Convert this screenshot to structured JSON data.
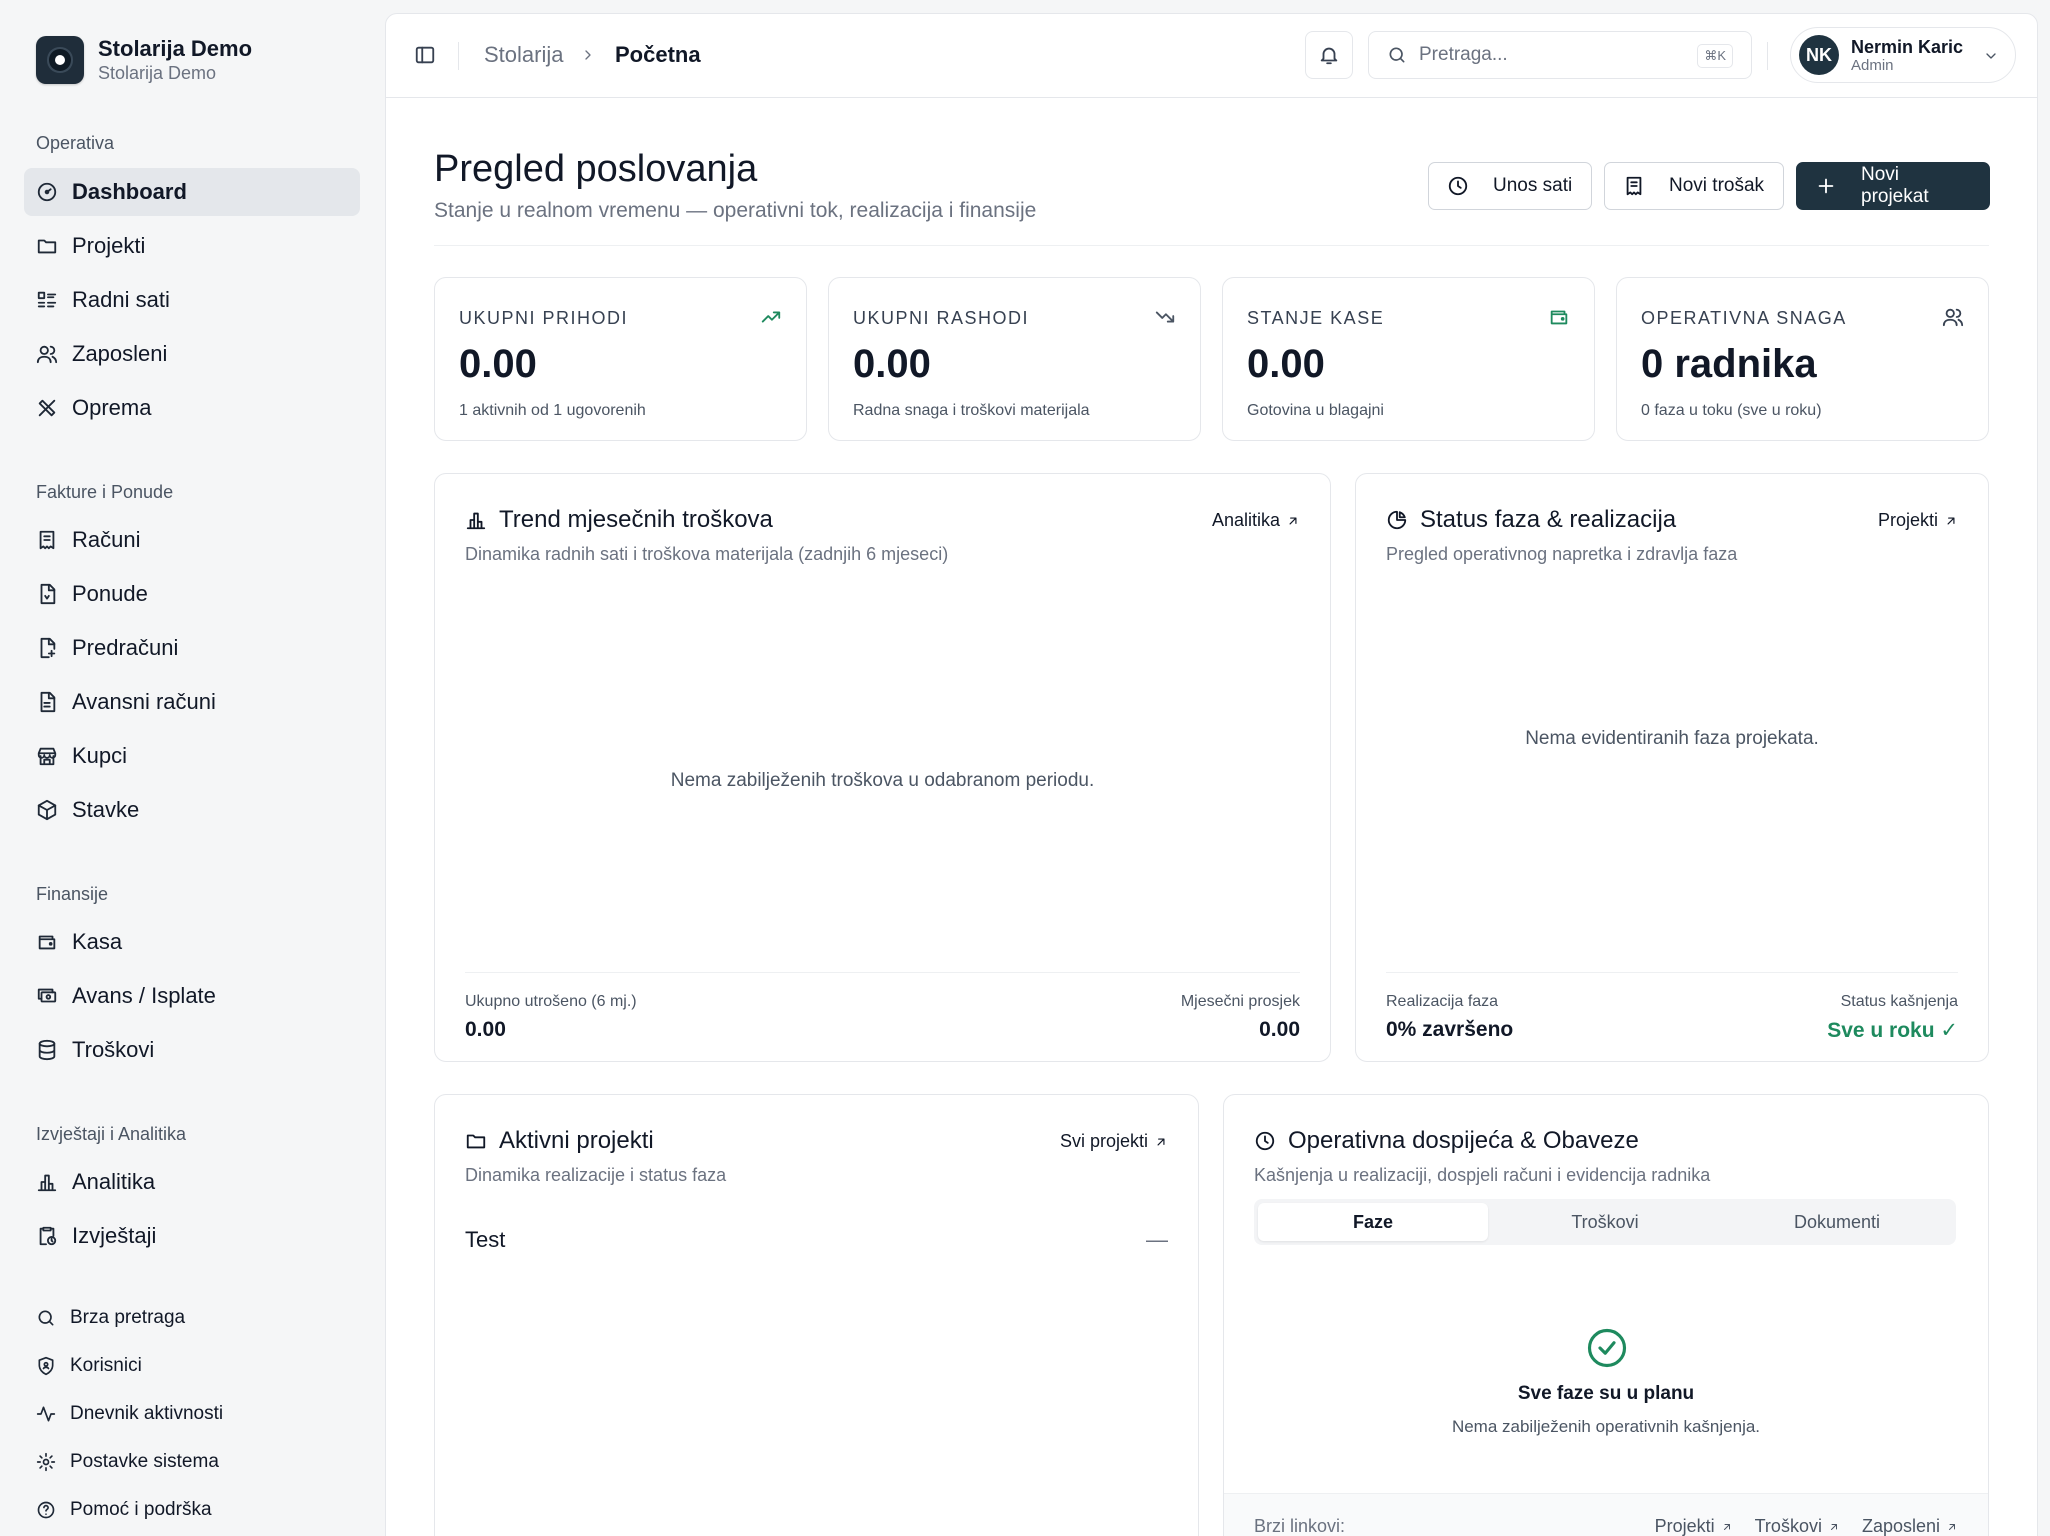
{
  "brand": {
    "name": "Stolarija Demo",
    "sub": "Stolarija Demo"
  },
  "sidebar": {
    "sections": [
      {
        "title": "Operativa"
      },
      {
        "title": "Fakture i Ponude"
      },
      {
        "title": "Finansije"
      },
      {
        "title": "Izvještaji i Analitika"
      }
    ],
    "items": [
      {
        "label": "Dashboard",
        "icon": "gauge-icon"
      },
      {
        "label": "Projekti",
        "icon": "folder-icon"
      },
      {
        "label": "Radni sati",
        "icon": "list-checks-icon"
      },
      {
        "label": "Zaposleni",
        "icon": "users-icon"
      },
      {
        "label": "Oprema",
        "icon": "tools-icon"
      },
      {
        "label": "Računi",
        "icon": "receipt-icon"
      },
      {
        "label": "Ponude",
        "icon": "file-quote-icon"
      },
      {
        "label": "Predračuni",
        "icon": "file-ai-icon"
      },
      {
        "label": "Avansni računi",
        "icon": "file-text-icon"
      },
      {
        "label": "Kupci",
        "icon": "store-icon"
      },
      {
        "label": "Stavke",
        "icon": "package-icon"
      },
      {
        "label": "Kasa",
        "icon": "wallet-icon"
      },
      {
        "label": "Avans / Isplate",
        "icon": "cash-icon"
      },
      {
        "label": "Troškovi",
        "icon": "database-icon"
      },
      {
        "label": "Analitika",
        "icon": "bar-chart-icon"
      },
      {
        "label": "Izvještaji",
        "icon": "report-icon"
      }
    ],
    "bottom": [
      {
        "label": "Brza pretraga",
        "icon": "search-icon"
      },
      {
        "label": "Korisnici",
        "icon": "shield-icon"
      },
      {
        "label": "Dnevnik aktivnosti",
        "icon": "activity-icon"
      },
      {
        "label": "Postavke sistema",
        "icon": "gear-icon"
      },
      {
        "label": "Pomoć i podrška",
        "icon": "help-icon"
      }
    ]
  },
  "header": {
    "breadcrumb": [
      "Stolarija",
      "Početna"
    ],
    "search_placeholder": "Pretraga...",
    "shortcut": "⌘K",
    "user": {
      "initials": "NK",
      "name": "Nermin Karic",
      "role": "Admin"
    }
  },
  "page": {
    "title": "Pregled poslovanja",
    "subtitle": "Stanje u realnom vremenu — operativni tok, realizacija i finansije",
    "actions": {
      "hours": "Unos sati",
      "expense": "Novi trošak",
      "project": "Novi projekat"
    }
  },
  "kpis": [
    {
      "label": "UKUPNI PRIHODI",
      "value": "0.00",
      "desc": "1 aktivnih od 1 ugovorenih",
      "icon": "trending-up-icon",
      "color": "#1e8a5e"
    },
    {
      "label": "UKUPNI RASHODI",
      "value": "0.00",
      "desc": "Radna snaga i troškovi materijala",
      "icon": "trending-down-icon",
      "color": "#4b5563"
    },
    {
      "label": "STANJE KASE",
      "value": "0.00",
      "desc": "Gotovina u blagajni",
      "icon": "wallet-icon",
      "color": "#1e8a5e"
    },
    {
      "label": "OPERATIVNA SNAGA",
      "value": "0 radnika",
      "desc": "0 faza u toku (sve u roku)",
      "icon": "users-icon",
      "color": "#374151"
    }
  ],
  "trend": {
    "title": "Trend mjesečnih troškova",
    "subtitle": "Dinamika radnih sati i troškova materijala (zadnjih 6 mjeseci)",
    "link": "Analitika",
    "empty": "Nema zabilježenih troškova u odabranom periodu.",
    "total_label": "Ukupno utrošeno (6 mj.)",
    "total_value": "0.00",
    "avg_label": "Mjesečni prosjek",
    "avg_value": "0.00"
  },
  "status": {
    "title": "Status faza & realizacija",
    "subtitle": "Pregled operativnog napretka i zdravlja faza",
    "link": "Projekti",
    "empty": "Nema evidentiranih faza projekata.",
    "real_label": "Realizacija faza",
    "real_value": "0% završeno",
    "delay_label": "Status kašnjenja",
    "delay_value": "Sve u roku ✓",
    "ok_color": "#1e8a5e"
  },
  "projects": {
    "title": "Aktivni projekti",
    "subtitle": "Dinamika realizacije i status faza",
    "link": "Svi projekti",
    "items": [
      {
        "name": "Test",
        "status": "—"
      }
    ]
  },
  "obligations": {
    "title": "Operativna dospijeća & Obaveze",
    "subtitle": "Kašnjenja u realizaciji, dospjeli računi i evidencija radnika",
    "tabs": [
      "Faze",
      "Troškovi",
      "Dokumenti"
    ],
    "ok_title": "Sve faze su u planu",
    "ok_sub": "Nema zabilježenih operativnih kašnjenja.",
    "quick_label": "Brzi linkovi:",
    "quick_links": [
      "Projekti",
      "Troškovi",
      "Zaposleni"
    ]
  }
}
